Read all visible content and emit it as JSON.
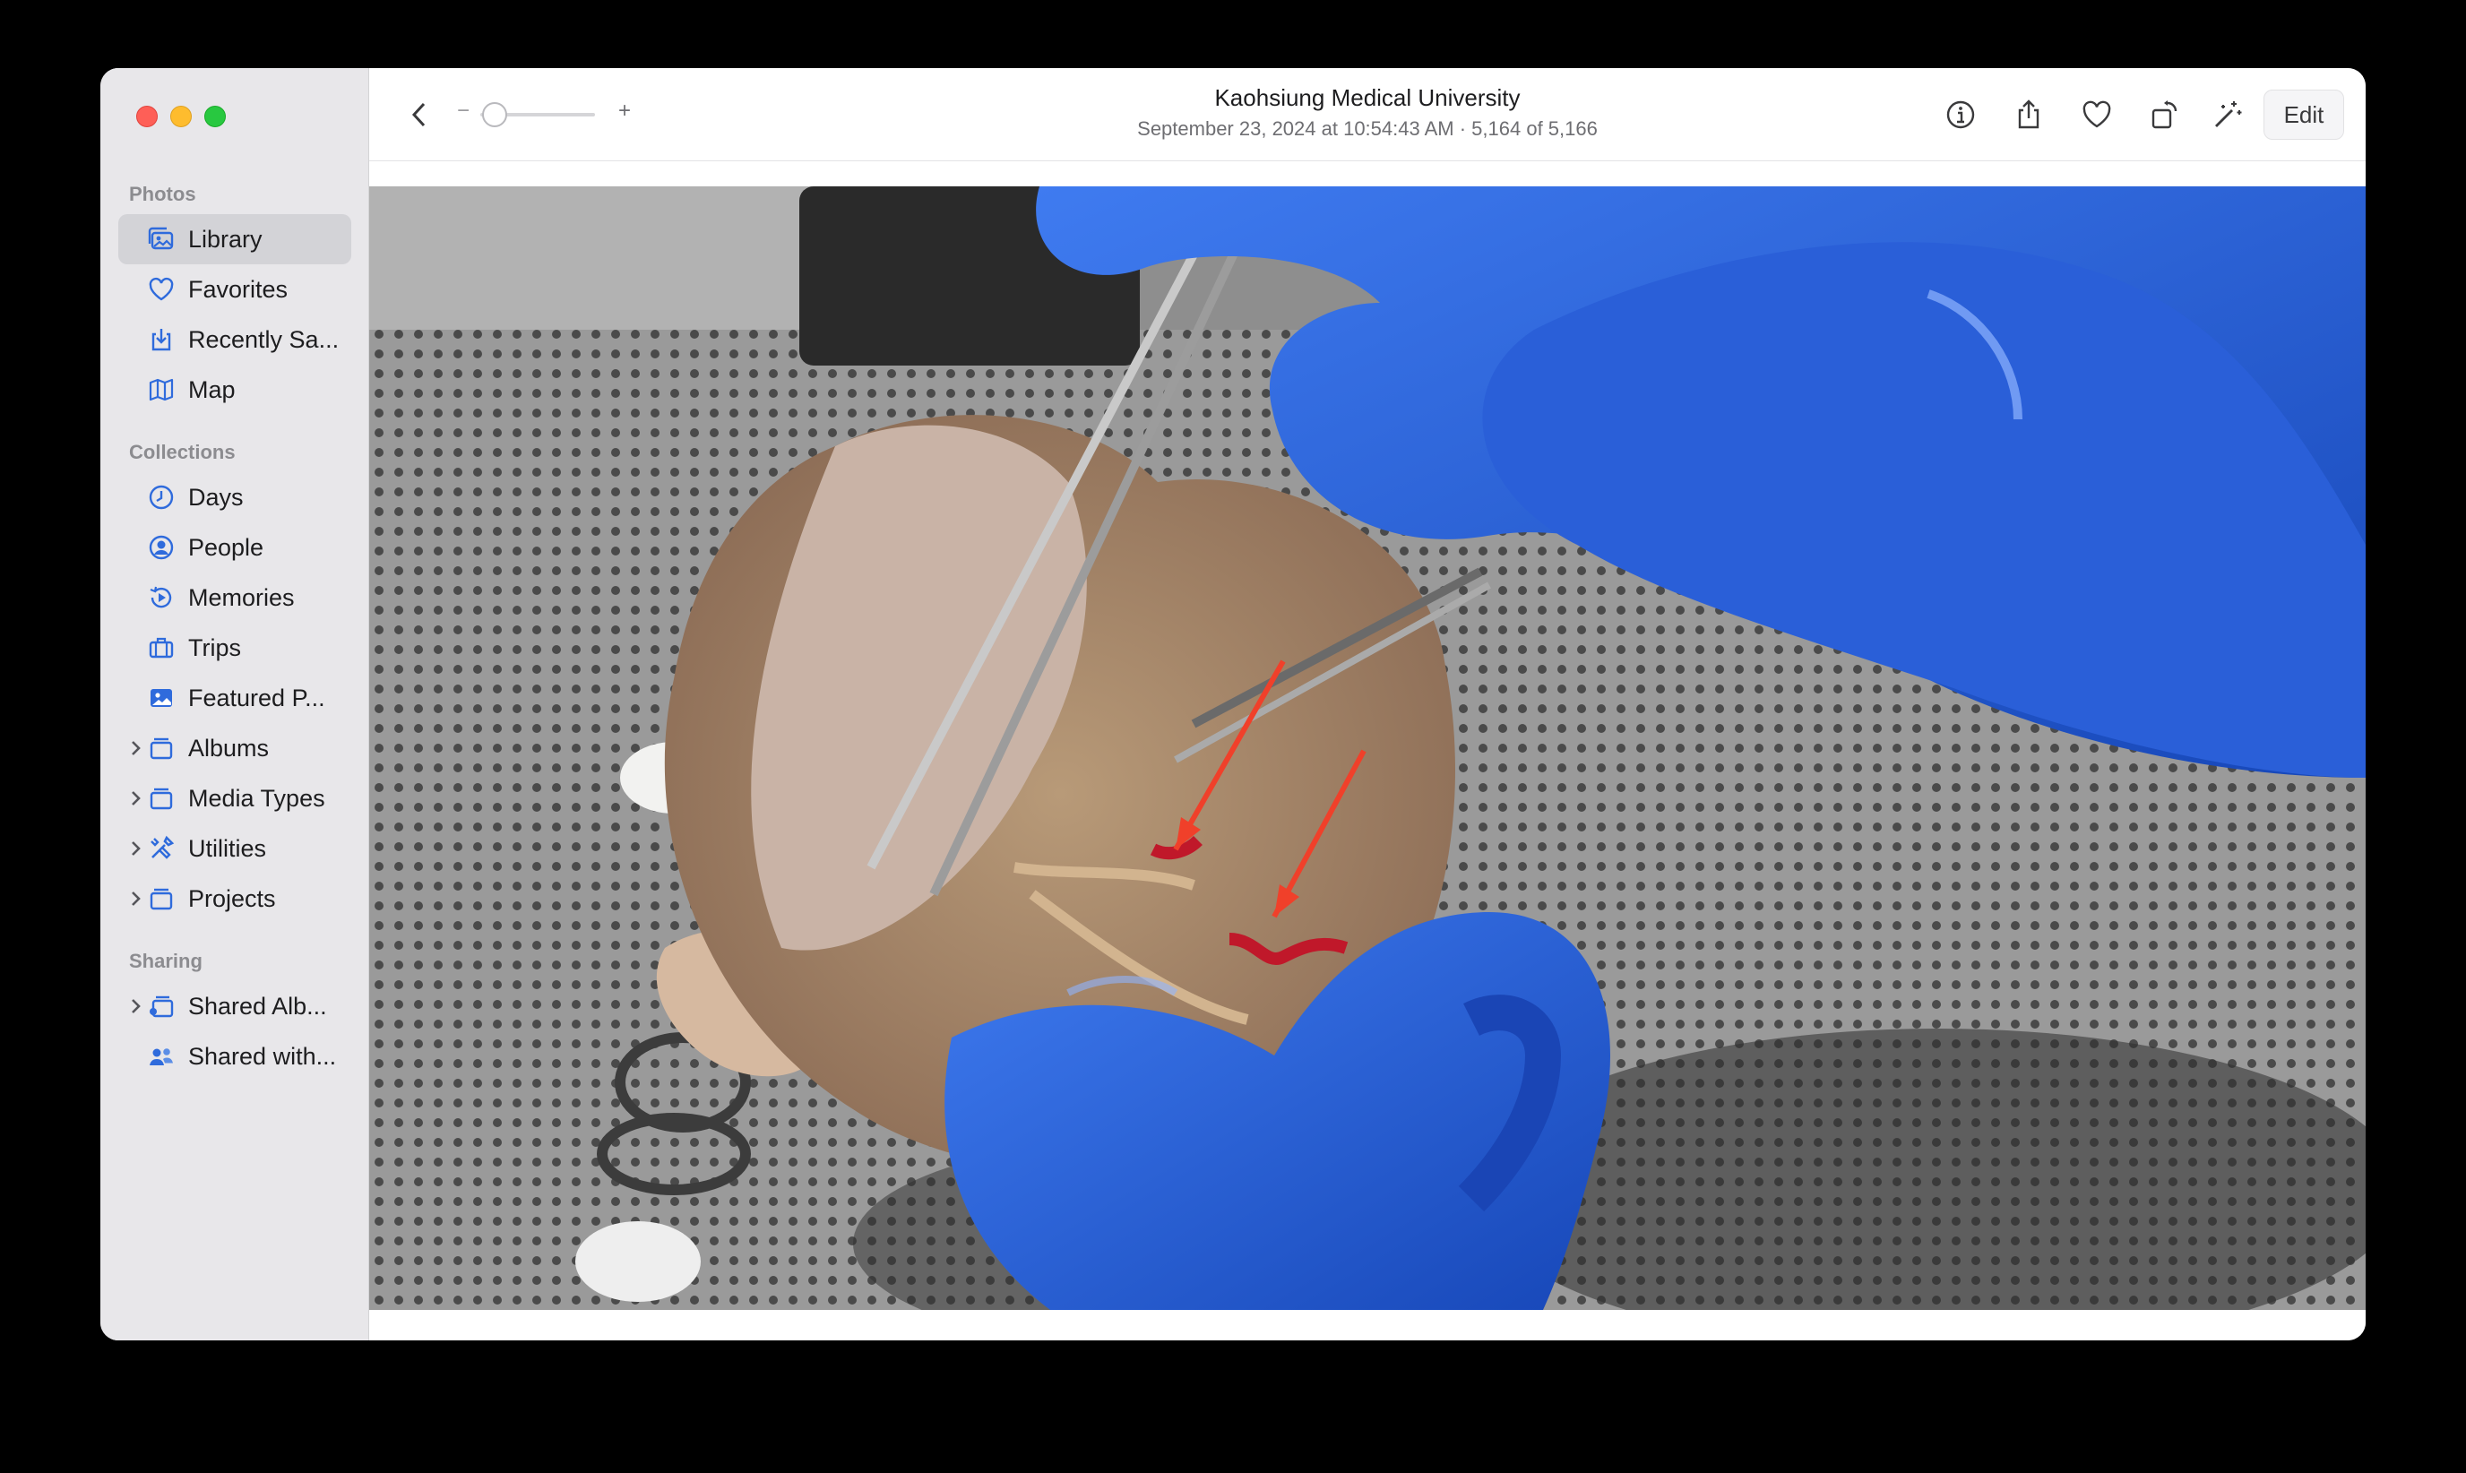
{
  "window": {
    "traffic_lights": [
      "close",
      "minimize",
      "zoom"
    ]
  },
  "sidebar": {
    "sections": [
      {
        "title": "Photos",
        "items": [
          {
            "label": "Library",
            "icon": "photo-library-icon",
            "selected": true
          },
          {
            "label": "Favorites",
            "icon": "heart-icon"
          },
          {
            "label": "Recently Sa...",
            "icon": "download-icon"
          },
          {
            "label": "Map",
            "icon": "map-icon"
          }
        ]
      },
      {
        "title": "Collections",
        "items": [
          {
            "label": "Days",
            "icon": "clock-icon"
          },
          {
            "label": "People",
            "icon": "person-circle-icon"
          },
          {
            "label": "Memories",
            "icon": "memories-icon"
          },
          {
            "label": "Trips",
            "icon": "suitcase-icon"
          },
          {
            "label": "Featured P...",
            "icon": "photo-icon"
          },
          {
            "label": "Albums",
            "icon": "stack-icon",
            "expandable": true
          },
          {
            "label": "Media Types",
            "icon": "stack-icon",
            "expandable": true
          },
          {
            "label": "Utilities",
            "icon": "tools-icon",
            "expandable": true
          },
          {
            "label": "Projects",
            "icon": "stack-icon",
            "expandable": true
          }
        ]
      },
      {
        "title": "Sharing",
        "items": [
          {
            "label": "Shared Alb...",
            "icon": "shared-album-icon",
            "expandable": true
          },
          {
            "label": "Shared with...",
            "icon": "people-icon"
          }
        ]
      }
    ]
  },
  "toolbar": {
    "zoom_minus": "−",
    "zoom_plus": "+",
    "title": "Kaohsiung Medical University",
    "subtitle": "September 23, 2024 at 10:54:43 AM  ·  5,164 of 5,166",
    "edit_label": "Edit",
    "icons": [
      "info-icon",
      "share-icon",
      "heart-icon",
      "rotate-icon",
      "magic-wand-icon"
    ]
  },
  "colors": {
    "accent": "#2f6bdc",
    "sidebar_bg": "#e8e7ea",
    "selected_bg": "#d3d3d7"
  }
}
